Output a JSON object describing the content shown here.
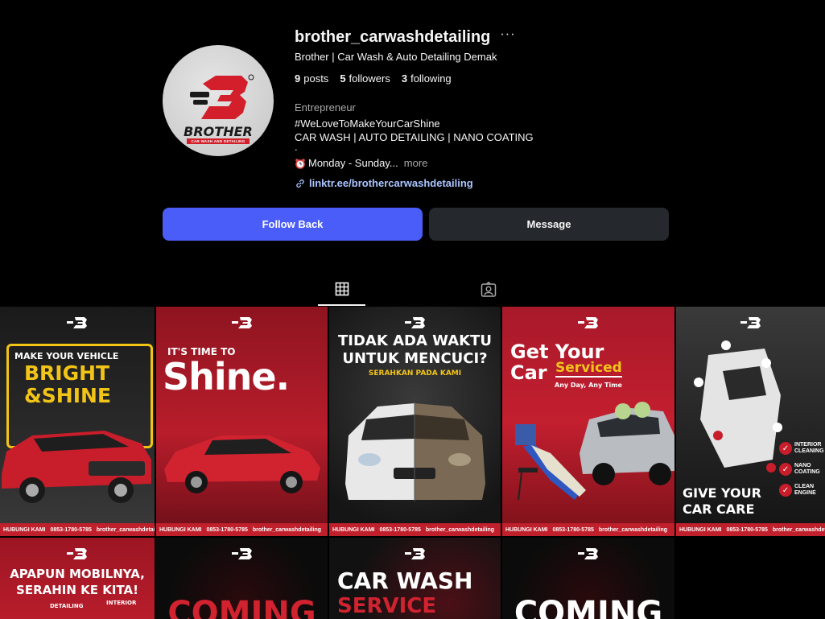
{
  "profile": {
    "username": "brother_carwashdetailing",
    "more_icon": "more-horizontal-icon",
    "full_name": "Brother | Car Wash & Auto Detailing Demak",
    "stats": {
      "posts_count": "9",
      "posts_label": "posts",
      "followers_count": "5",
      "followers_label": "followers",
      "following_count": "3",
      "following_label": "following"
    },
    "category": "Entrepreneur",
    "bio": {
      "line1": "#WeLoveToMakeYourCarShine",
      "line2": "CAR WASH | AUTO DETAILING | NANO COATING",
      "line3": ".",
      "hours": "Monday - Sunday...",
      "hours_more": "more"
    },
    "link": "linktr.ee/brothercarwashdetailing",
    "avatar": {
      "brand": "BROTHER",
      "tagline": "CAR WASH AND DETAILING",
      "colors": {
        "red": "#d21f2b",
        "dark": "#1a1a1a"
      }
    }
  },
  "actions": {
    "follow_back": "Follow Back",
    "message": "Message"
  },
  "tabs": [
    {
      "name": "posts",
      "icon": "grid-icon",
      "active": true
    },
    {
      "name": "tagged",
      "icon": "tagged-icon",
      "active": false
    }
  ],
  "posts": {
    "footer_cta": "HUBUNGI KAMI",
    "footer_phone": "0853-1780-5785",
    "footer_handle": "brother_carwashdetailing",
    "row1": [
      {
        "line1": "MAKE YOUR VEHICLE",
        "line2": "BRIGHT",
        "line3": "&SHINE"
      },
      {
        "line1": "IT'S TIME TO",
        "line2": "Shine."
      },
      {
        "line1": "TIDAK ADA WAKTU",
        "line2": "UNTUK MENCUCI?",
        "line3": "SERAHKAN PADA KAMI"
      },
      {
        "line1": "Get Your",
        "line2": "Car",
        "line3": "Serviced",
        "line4": "Any Day, Any Time"
      },
      {
        "line1": "GIVE YOUR",
        "line2": "CAR CARE",
        "badges": [
          "INTERIOR CLEANING",
          "NANO COATING",
          "CLEAN ENGINE"
        ]
      }
    ],
    "row2": [
      {
        "line1": "APAPUN MOBILNYA,",
        "line2": "SERAHIN KE KITA!",
        "line3": "DETAILING",
        "line4": "INTERIOR"
      },
      {
        "line1": "COMING"
      },
      {
        "line1": "CAR WASH",
        "line2": "SERVICE"
      },
      {
        "line1": "COMING"
      }
    ]
  },
  "colors": {
    "background": "#000000",
    "primary_button": "#4a5df9",
    "secondary_button": "#25292e",
    "brand_red": "#c0202c",
    "accent_yellow": "#f2c418"
  }
}
